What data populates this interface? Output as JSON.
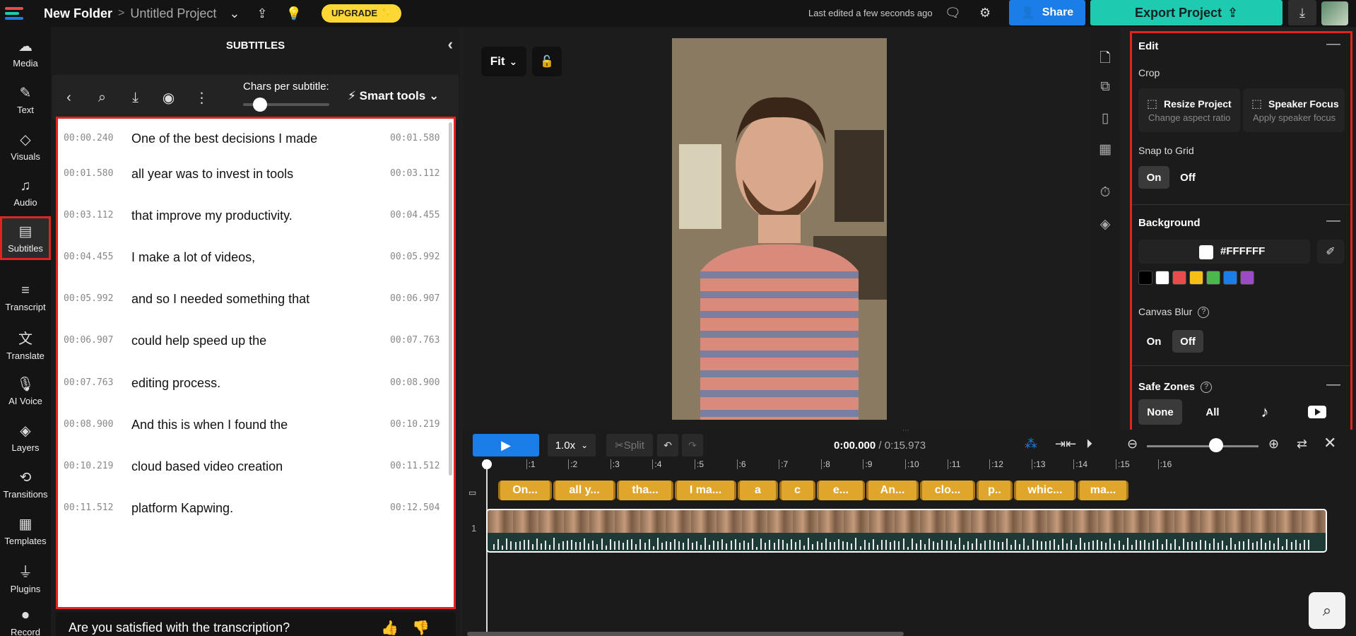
{
  "topbar": {
    "folder": "New Folder",
    "separator": ">",
    "project": "Untitled Project",
    "upgrade_label": "UPGRADE ✨",
    "last_edited": "Last edited a few seconds ago",
    "share_label": "Share",
    "export_label": "Export Project"
  },
  "sidebar": {
    "items": [
      {
        "label": "Media"
      },
      {
        "label": "Text"
      },
      {
        "label": "Visuals"
      },
      {
        "label": "Audio"
      },
      {
        "label": "Subtitles"
      },
      {
        "label": "Transcript"
      },
      {
        "label": "Translate"
      },
      {
        "label": "AI Voice"
      },
      {
        "label": "Layers"
      },
      {
        "label": "Transitions"
      },
      {
        "label": "Templates"
      },
      {
        "label": "Plugins"
      },
      {
        "label": "Record"
      }
    ]
  },
  "subtitles": {
    "title": "SUBTITLES",
    "chars_label": "Chars per subtitle:",
    "chars_level": 0.15,
    "smart_tools_label": "Smart tools",
    "rows": [
      {
        "start": "00:00.240",
        "text": "One of the best decisions I made",
        "end": "00:01.580"
      },
      {
        "start": "00:01.580",
        "text": "all year was to invest in tools",
        "end": "00:03.112"
      },
      {
        "start": "00:03.112",
        "text": "that improve my productivity.",
        "end": "00:04.455"
      },
      {
        "start": "00:04.455",
        "text": "I make a lot of videos,",
        "end": "00:05.992"
      },
      {
        "start": "00:05.992",
        "text": "and so I needed something that",
        "end": "00:06.907"
      },
      {
        "start": "00:06.907",
        "text": "could help speed up the",
        "end": "00:07.763"
      },
      {
        "start": "00:07.763",
        "text": "editing process.",
        "end": "00:08.900"
      },
      {
        "start": "00:08.900",
        "text": "And this is when I found the",
        "end": "00:10.219"
      },
      {
        "start": "00:10.219",
        "text": "cloud based video creation",
        "end": "00:11.512"
      },
      {
        "start": "00:11.512",
        "text": "platform Kapwing.",
        "end": "00:12.504"
      }
    ],
    "feedback_question": "Are you satisfied with the transcription?"
  },
  "canvas": {
    "fit_label": "Fit"
  },
  "edit_panel": {
    "title": "Edit",
    "crop_label": "Crop",
    "resize_title": "Resize Project",
    "resize_sub": "Change aspect ratio",
    "speaker_title": "Speaker Focus",
    "speaker_sub": "Apply speaker focus",
    "snap_label": "Snap to Grid",
    "on_label": "On",
    "off_label": "Off",
    "snap_selected": "On",
    "background_title": "Background",
    "background_hex": "#FFFFFF",
    "palette": [
      "#000000",
      "#FFFFFF",
      "#E84C4C",
      "#F5C016",
      "#4CB84C",
      "#1A7DE8",
      "#9B4CC4"
    ],
    "canvas_blur_label": "Canvas Blur",
    "canvas_blur_selected": "Off",
    "safe_zones_title": "Safe Zones",
    "safe_none": "None",
    "safe_all": "All",
    "safe_selected": "None"
  },
  "timeline": {
    "speed": "1.0x",
    "split_label": "Split",
    "current_time": "0:00.000",
    "total_time": "/ 0:15.973",
    "zoom_level": 0.62,
    "ruler_ticks": [
      "0",
      ":1",
      ":2",
      ":3",
      ":4",
      ":5",
      ":6",
      ":7",
      ":8",
      ":9",
      ":10",
      ":11",
      ":12",
      ":13",
      ":14",
      ":15",
      ":16"
    ],
    "track_number": "1",
    "subtitle_clips": [
      "On...",
      "all y...",
      "tha...",
      "I ma...",
      "a",
      "c",
      "e...",
      "An...",
      "clo...",
      "p..",
      "whic...",
      "ma..."
    ]
  },
  "colors": {
    "accent_blue": "#1A7DE8",
    "export_teal": "#1FCBB0",
    "upgrade_yellow": "#FDD835",
    "highlight_red": "#E0241F",
    "subtitle_clip": "#E0A62C"
  }
}
